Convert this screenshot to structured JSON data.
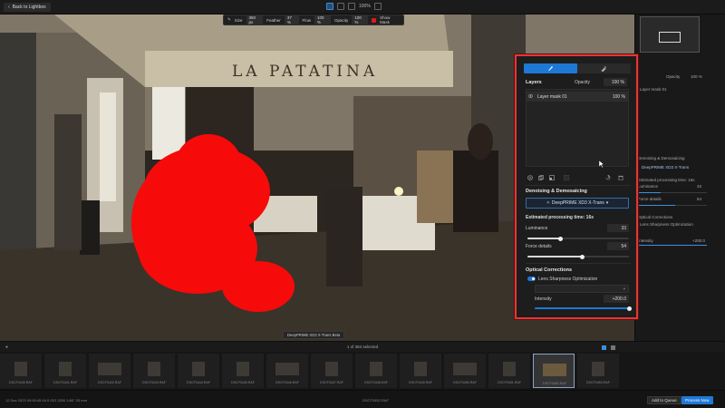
{
  "topbar": {
    "back_label": "Back to Lightbox",
    "zoom": "100%"
  },
  "brush_options": {
    "size_label": "Size",
    "size_value": "350 px",
    "feather_label": "Feather",
    "feather_value": "37 %",
    "flow_label": "Flow",
    "flow_value": "100 %",
    "opacity_label": "Opacity",
    "opacity_value": "100 %",
    "show_mask_label": "Show Mask",
    "mask_color": "#e01818"
  },
  "photo": {
    "sign_text": "LA PATATINA"
  },
  "local_panel": {
    "layers_title": "Layers",
    "opacity_label": "Opacity",
    "opacity_value": "100 %",
    "layer": {
      "name": "Layer mask 01",
      "opacity": "100 %"
    },
    "denoise_title": "Denoising & Demosaicing",
    "denoise_mode": "DeepPRIME XD3 X-Trans",
    "processing_time": "Estimated processing time: 16s",
    "luminance": {
      "label": "Luminance",
      "value": 33,
      "max": 100
    },
    "force_details": {
      "label": "Force details",
      "value": 54,
      "max": 100
    },
    "optical_title": "Optical Corrections",
    "lens_sharpness_label": "Lens Sharpness Optimization",
    "lens_sharpness_enabled": true,
    "intensity": {
      "label": "Intensity",
      "value": "+200.0",
      "fraction": 1.0
    }
  },
  "right_panel": {
    "opacity_label": "Opacity",
    "opacity_value": "100 %",
    "layer_name": "Layer mask 01",
    "denoise_title": "Denoising & Demosaicing",
    "denoise_mode": "DeepPRIME XD3 X-Trans",
    "processing_time": "Estimated processing time: 16s",
    "luminance_label": "Luminance",
    "luminance_value": "33",
    "force_details_label": "Force details",
    "force_details_value": "54",
    "optical_title": "Optical Corrections",
    "lens_sharpness_label": "Lens Sharpness Optimization",
    "intensity_label": "Intensity",
    "intensity_value": "+200.0"
  },
  "filmstrip": {
    "tooltip": "DeepPRIME XD3 X-Trans Beta",
    "selection": "1 of 384 selected",
    "items": [
      {
        "file": "DSCF3440.RAF",
        "active": false
      },
      {
        "file": "DSCF3441.RAF",
        "active": false
      },
      {
        "file": "DSCF3442.RAF",
        "active": false
      },
      {
        "file": "DSCF3443.RAF",
        "active": false
      },
      {
        "file": "DSCF3444.RAF",
        "active": false
      },
      {
        "file": "DSCF3445.RAF",
        "active": false
      },
      {
        "file": "DSCF3446.RAF",
        "active": false
      },
      {
        "file": "DSCF3447.RAF",
        "active": false
      },
      {
        "file": "DSCF3448.RAF",
        "active": false
      },
      {
        "file": "DSCF3449.RAF",
        "active": false
      },
      {
        "file": "DSCF3450.RAF",
        "active": false
      },
      {
        "file": "DSCF3451.RAF",
        "active": false
      },
      {
        "file": "DSCF3452.RAF",
        "active": true
      },
      {
        "file": "DSCF3453.RAF",
        "active": false
      }
    ]
  },
  "statusbar": {
    "info": "12 Dec 2023 09:50:45   f/4.0   ISO 3200   1/60\"   23 mm",
    "filename": "DSCF3452.RAF",
    "add_queue": "Add to Queue",
    "process": "Process Now"
  }
}
